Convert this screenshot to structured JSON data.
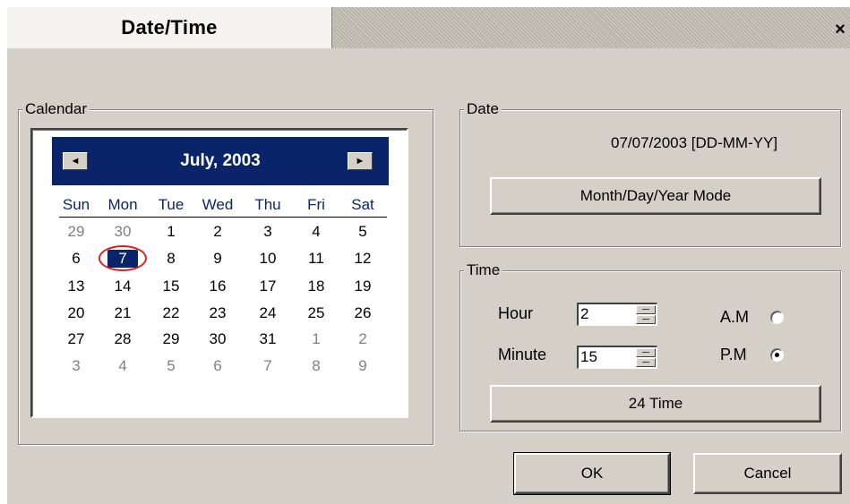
{
  "window": {
    "title": "Date/Time",
    "close_glyph": "×"
  },
  "calendar": {
    "group_label": "Calendar",
    "month_title": "July, 2003",
    "prev_glyph": "◄",
    "next_glyph": "►",
    "day_names": [
      "Sun",
      "Mon",
      "Tue",
      "Wed",
      "Thu",
      "Fri",
      "Sat"
    ],
    "weeks": [
      [
        "29",
        "30",
        "1",
        "2",
        "3",
        "4",
        "5"
      ],
      [
        "6",
        "7",
        "8",
        "9",
        "10",
        "11",
        "12"
      ],
      [
        "13",
        "14",
        "15",
        "16",
        "17",
        "18",
        "19"
      ],
      [
        "20",
        "21",
        "22",
        "23",
        "24",
        "25",
        "26"
      ],
      [
        "27",
        "28",
        "29",
        "30",
        "31",
        "1",
        "2"
      ],
      [
        "3",
        "4",
        "5",
        "6",
        "7",
        "8",
        "9"
      ]
    ],
    "selected_day": "7",
    "colors": {
      "header_bg": "#0a246a",
      "day_name": "#0a246a",
      "other_month": "#808080",
      "annotation_circle": "#e21d1d"
    }
  },
  "date": {
    "group_label": "Date",
    "display": "07/07/2003 [DD-MM-YY]",
    "mode_button": "Month/Day/Year Mode"
  },
  "time": {
    "group_label": "Time",
    "hour_label": "Hour",
    "hour_value": "2",
    "minute_label": "Minute",
    "minute_value": "15",
    "am_label": "A.M",
    "pm_label": "P.M",
    "selected_period": "P.M",
    "button_24": "24 Time"
  },
  "actions": {
    "ok": "OK",
    "cancel": "Cancel"
  }
}
